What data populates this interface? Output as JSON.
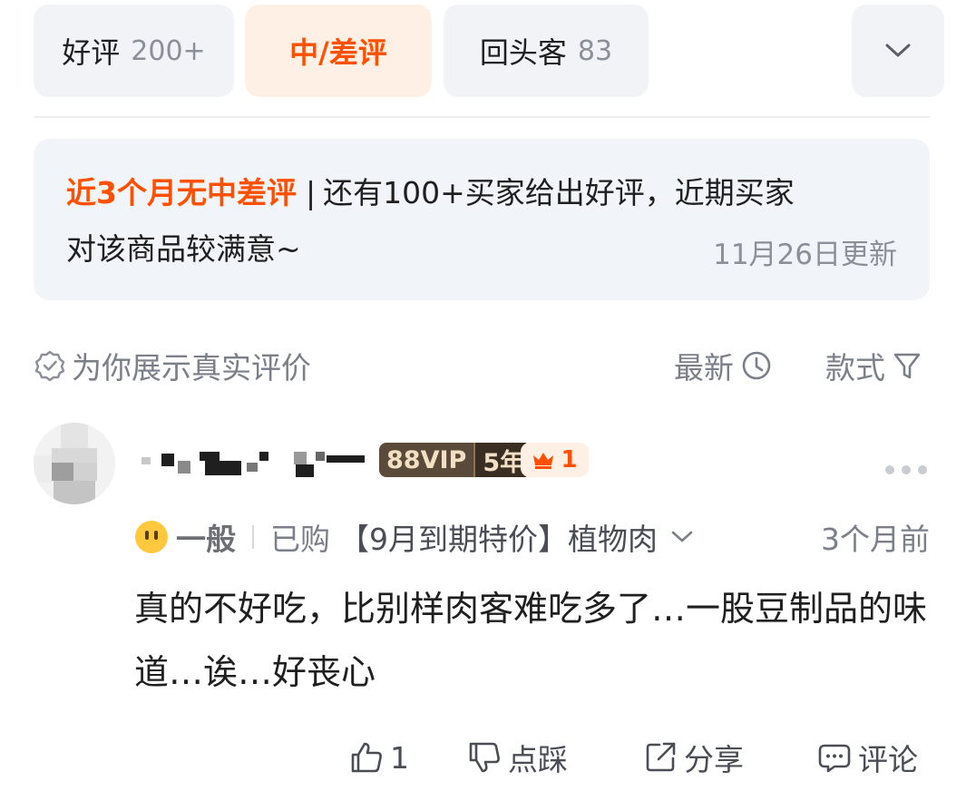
{
  "tabs": [
    {
      "label": "好评",
      "count": "200+"
    },
    {
      "label": "中/差评",
      "count": ""
    },
    {
      "label": "回头客",
      "count": "83"
    }
  ],
  "summary": {
    "highlight": "近3个月无中差评",
    "separator": "|",
    "text_line1": "还有100+买家给出好评，近期买家",
    "text_line2": "对该商品较满意~",
    "updated": "11月26日更新"
  },
  "toolbar": {
    "authentic_label": "为你展示真实评价",
    "sort_label": "最新",
    "style_label": "款式"
  },
  "review": {
    "vip_label": "88VIP",
    "vip_years": "5年",
    "level": "1",
    "rating": "一般",
    "bought": "已购",
    "sku": "【9月到期特价】植物肉",
    "time": "3个月前",
    "content": "真的不好吃，比别样肉客难吃多了…一股豆制品的味道…诶…好丧心",
    "actions": {
      "like": "1",
      "dislike": "点踩",
      "share": "分享",
      "comment": "评论"
    }
  },
  "colors": {
    "accent": "#ff5000",
    "tab_bg": "#f1f3f7",
    "active_tab_bg": "#fff0e6",
    "muted": "#7a7f89"
  },
  "icons": [
    "chevron-down-icon",
    "badge-check-icon",
    "clock-icon",
    "filter-icon",
    "crown-icon",
    "more-icon",
    "neutral-face-icon",
    "thumbs-up-icon",
    "thumbs-down-icon",
    "share-icon",
    "comment-icon"
  ]
}
